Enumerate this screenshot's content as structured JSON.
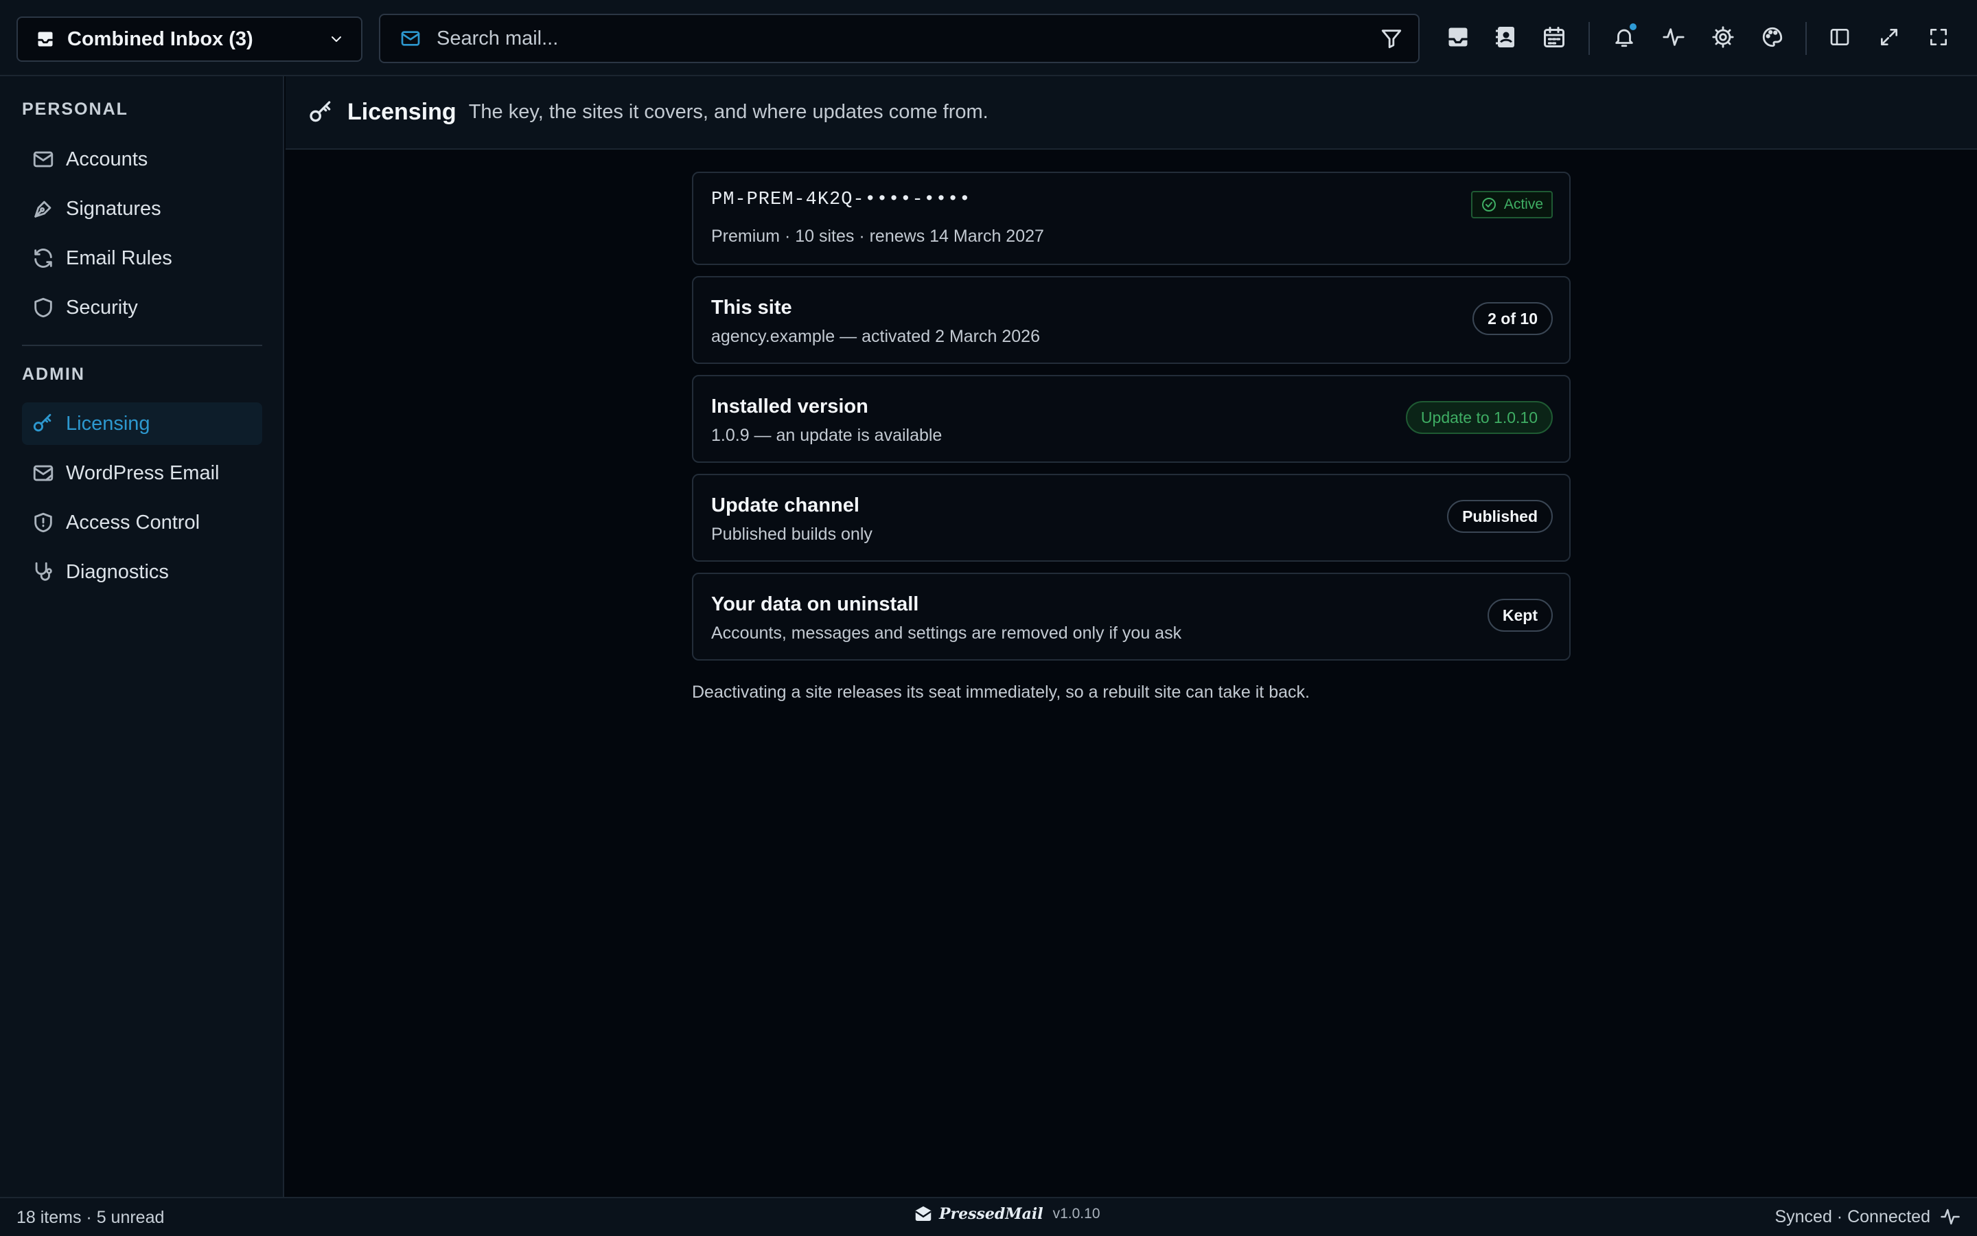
{
  "topbar": {
    "inbox_label": "Combined Inbox (3)",
    "search_placeholder": "Search mail...",
    "icons": [
      "inbox-icon",
      "contacts-icon",
      "calendar-icon",
      "bell-icon",
      "activity-icon",
      "settings-icon",
      "palette-icon",
      "sidebar-toggle-icon",
      "expand-icon",
      "fullscreen-icon"
    ],
    "notification_dot_color": "#2f9bd6"
  },
  "sidebar": {
    "personal_title": "PERSONAL",
    "personal_items": [
      {
        "label": "Accounts",
        "icon": "mail-icon"
      },
      {
        "label": "Signatures",
        "icon": "pen-icon"
      },
      {
        "label": "Email Rules",
        "icon": "refresh-icon"
      },
      {
        "label": "Security",
        "icon": "shield-icon"
      }
    ],
    "admin_title": "ADMIN",
    "admin_items": [
      {
        "label": "Licensing",
        "icon": "key-icon",
        "active": true
      },
      {
        "label": "WordPress Email",
        "icon": "mail-icon"
      },
      {
        "label": "Access Control",
        "icon": "shield-check-icon"
      },
      {
        "label": "Diagnostics",
        "icon": "stethoscope-icon"
      }
    ]
  },
  "header": {
    "title": "Licensing",
    "subtitle": "The key, the sites it covers, and where updates come from."
  },
  "license": {
    "key": "PM-PREM-4K2Q-••••-••••",
    "status": "Active",
    "details": "Premium · 10 sites · renews 14 March 2027"
  },
  "cards": [
    {
      "title": "This site",
      "subtitle": "agency.example — activated 2 March 2026",
      "pill": "2 of 10"
    },
    {
      "title": "Installed version",
      "subtitle": "1.0.9 — an update is available",
      "pill": "Update to 1.0.10"
    },
    {
      "title": "Update channel",
      "subtitle": "Published builds only",
      "pill": "Published"
    },
    {
      "title": "Your data on uninstall",
      "subtitle": "Accounts, messages and settings are removed only if you ask",
      "pill": "Kept"
    }
  ],
  "footnote": "Deactivating a site releases its seat immediately, so a rebuilt site can take it back.",
  "status": {
    "left": "18 items · 5 unread",
    "brand": "PressedMail",
    "version": "v1.0.10",
    "right": "Synced · Connected"
  },
  "colors": {
    "accent": "#2d98cf",
    "success": "#3fae64",
    "background": "#03070d",
    "panel": "#0a121b"
  }
}
